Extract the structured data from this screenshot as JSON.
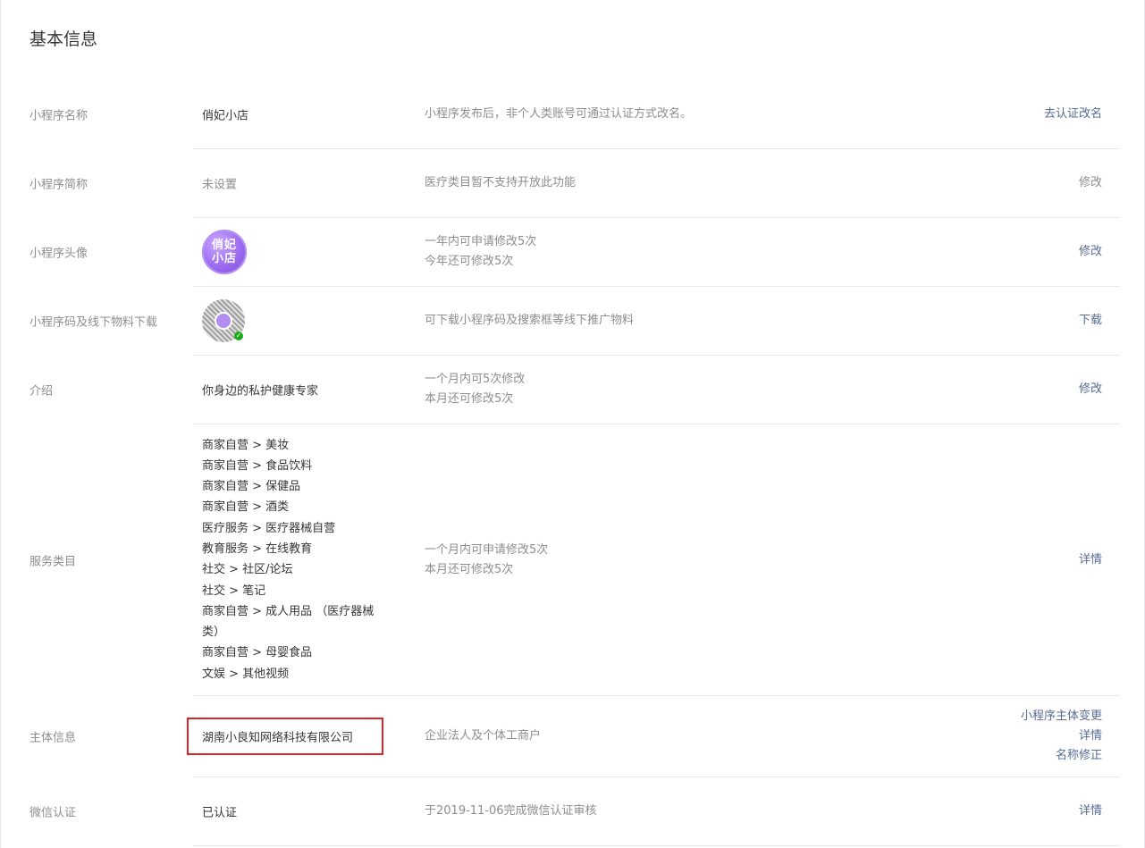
{
  "section": {
    "title": "基本信息"
  },
  "rows": {
    "name": {
      "label": "小程序名称",
      "value": "俏妃小店",
      "desc": "小程序发布后，非个人类账号可通过认证方式改名。",
      "action": "去认证改名"
    },
    "short_name": {
      "label": "小程序简称",
      "value": "未设置",
      "desc": "医疗类目暂不支持开放此功能",
      "action": "修改"
    },
    "avatar": {
      "label": "小程序头像",
      "avatar_text": [
        "俏妃",
        "小店"
      ],
      "desc_lines": [
        "一年内可申请修改5次",
        "今年还可修改5次"
      ],
      "action": "修改"
    },
    "qrcode": {
      "label": "小程序码及线下物料下载",
      "desc": "可下载小程序码及搜索框等线下推广物料",
      "action": "下载"
    },
    "intro": {
      "label": "介绍",
      "value": "你身边的私护健康专家",
      "desc_lines": [
        "一个月内可5次修改",
        "本月还可修改5次"
      ],
      "action": "修改"
    },
    "categories": {
      "label": "服务类目",
      "items": [
        "商家自营 > 美妆",
        "商家自营 > 食品饮料",
        "商家自营 > 保健品",
        "商家自营 > 酒类",
        "医疗服务 > 医疗器械自营",
        "教育服务 > 在线教育",
        "社交 > 社区/论坛",
        "社交 > 笔记",
        "商家自营 > 成人用品 （医疗器械",
        "类）",
        "商家自营 > 母婴食品",
        "文娱 > 其他视频"
      ],
      "desc_lines": [
        "一个月内可申请修改5次",
        "本月还可修改5次"
      ],
      "action": "详情"
    },
    "entity": {
      "label": "主体信息",
      "value": "湖南小良知网络科技有限公司",
      "desc": "企业法人及个体工商户",
      "actions": [
        "小程序主体变更",
        "详情",
        "名称修正"
      ]
    },
    "wechat_cert": {
      "label": "微信认证",
      "value": "已认证",
      "desc": "于2019-11-06完成微信认证审核",
      "action": "详情"
    }
  },
  "colors": {
    "link": "#576b95",
    "muted": "#8d8d8d",
    "text": "#353535",
    "highlight": "#d9252a",
    "divider": "#e7e7eb"
  }
}
